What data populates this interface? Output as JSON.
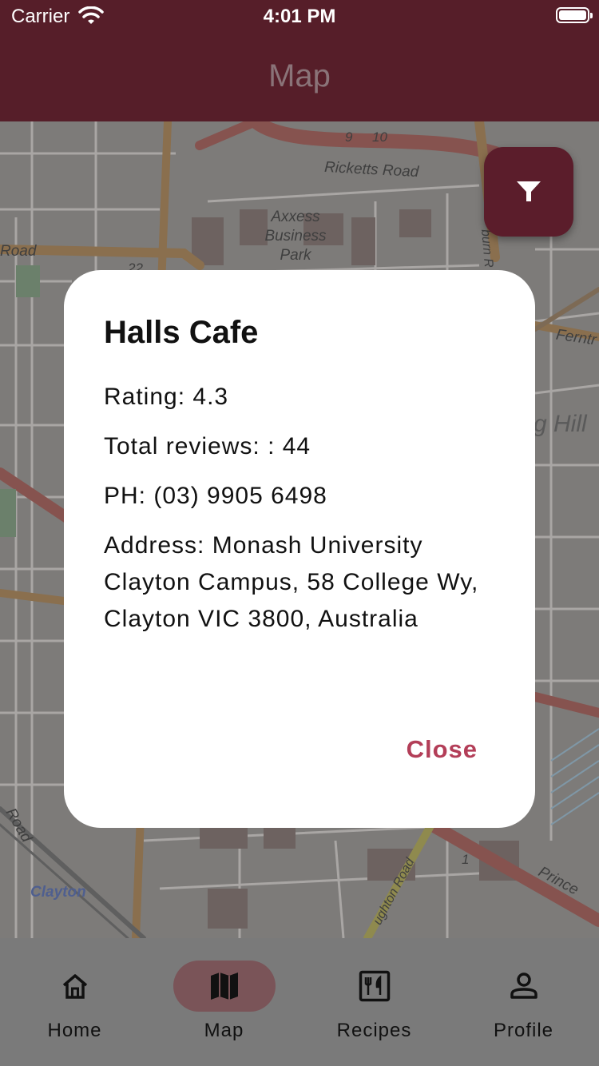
{
  "status_bar": {
    "carrier": "Carrier",
    "time": "4:01 PM"
  },
  "app_bar": {
    "title": "Map"
  },
  "map": {
    "labels": {
      "ricketts_road": "Ricketts Road",
      "axxess_business_park": "Axxess\nBusiness\nPark",
      "road_fragment_left": "Road",
      "clayton": "Clayton",
      "road_fragment_bottom": "Road",
      "ferntree": "Ferntr",
      "hill_fragment": "g Hill",
      "princes": "Prince",
      "burn_fragment": "burn R",
      "route_9": "9",
      "route_10": "10",
      "route_22": "22",
      "route_1": "1",
      "oughton_road": "ughton Road"
    }
  },
  "filter_button": {
    "icon": "filter-icon"
  },
  "dialog": {
    "title": "Halls Cafe",
    "rating": "Rating: 4.3",
    "total_reviews": "Total reviews: : 44",
    "phone": "PH: (03) 9905 6498",
    "address": "Address: Monash University Clayton Campus, 58 College Wy, Clayton VIC 3800, Australia",
    "close_label": "Close"
  },
  "bottom_nav": {
    "items": [
      {
        "label": "Home",
        "icon": "home-icon",
        "active": false
      },
      {
        "label": "Map",
        "icon": "map-icon",
        "active": true
      },
      {
        "label": "Recipes",
        "icon": "recipes-icon",
        "active": false
      },
      {
        "label": "Profile",
        "icon": "profile-icon",
        "active": false
      }
    ]
  },
  "colors": {
    "primary": "#561e29",
    "accent": "#b33e58",
    "dialog_bg": "#ffffff"
  }
}
